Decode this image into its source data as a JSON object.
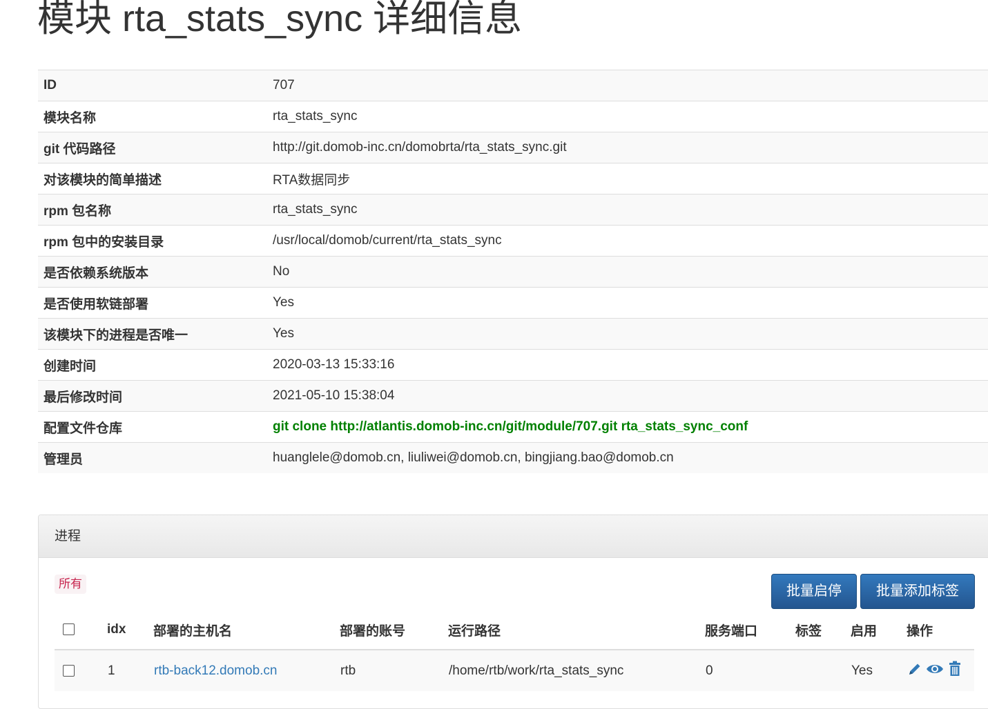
{
  "page": {
    "title": "模块 rta_stats_sync 详细信息"
  },
  "info": {
    "rows": [
      {
        "label": "ID",
        "value": "707"
      },
      {
        "label": "模块名称",
        "value": "rta_stats_sync"
      },
      {
        "label": "git 代码路径",
        "value": "http://git.domob-inc.cn/domobrta/rta_stats_sync.git"
      },
      {
        "label": "对该模块的简单描述",
        "value": "RTA数据同步"
      },
      {
        "label": "rpm 包名称",
        "value": "rta_stats_sync"
      },
      {
        "label": "rpm 包中的安装目录",
        "value": "/usr/local/domob/current/rta_stats_sync"
      },
      {
        "label": "是否依赖系统版本",
        "value": "No"
      },
      {
        "label": "是否使用软链部署",
        "value": "Yes"
      },
      {
        "label": "该模块下的进程是否唯一",
        "value": "Yes"
      },
      {
        "label": "创建时间",
        "value": "2020-03-13 15:33:16"
      },
      {
        "label": "最后修改时间",
        "value": "2021-05-10 15:38:04"
      },
      {
        "label": "配置文件仓库",
        "value": "git clone http://atlantis.domob-inc.cn/git/module/707.git rta_stats_sync_conf"
      },
      {
        "label": "管理员",
        "value": "huanglele@domob.cn, liuliwei@domob.cn, bingjiang.bao@domob.cn"
      }
    ]
  },
  "process_panel": {
    "heading": "进程",
    "filter_label": "所有",
    "buttons": {
      "batch_toggle": "批量启停",
      "batch_add_tag": "批量添加标签"
    },
    "columns": {
      "idx": "idx",
      "host": "部署的主机名",
      "account": "部署的账号",
      "run_path": "运行路径",
      "port": "服务端口",
      "tags": "标签",
      "enabled": "启用",
      "actions": "操作"
    },
    "rows": [
      {
        "idx": "1",
        "host": "rtb-back12.domob.cn",
        "account": "rtb",
        "run_path": "/home/rtb/work/rta_stats_sync",
        "port": "0",
        "tags": "",
        "enabled": "Yes",
        "actions": [
          "pencil-icon",
          "eye-icon",
          "trash-icon"
        ]
      }
    ]
  },
  "colors": {
    "link": "#337ab7",
    "green_text": "#008000",
    "button_primary": "#286090",
    "filter_tag": "#c7254e"
  }
}
